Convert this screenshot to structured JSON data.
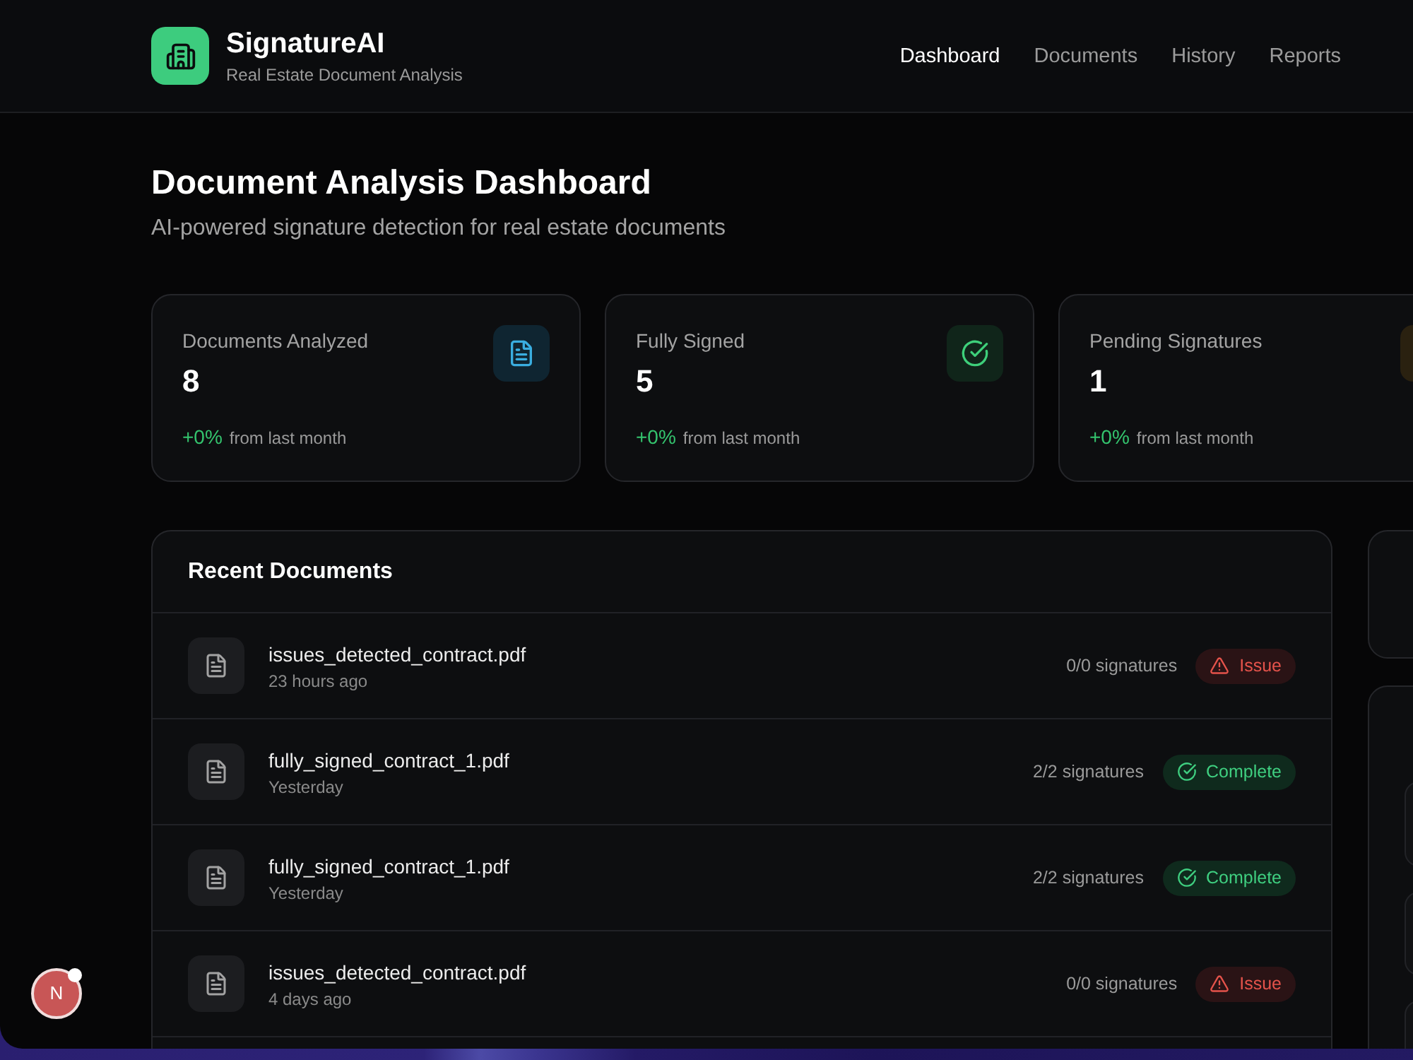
{
  "header": {
    "app_name": "SignatureAI",
    "tagline": "Real Estate Document Analysis",
    "nav": [
      {
        "label": "Dashboard",
        "selected": true
      },
      {
        "label": "Documents",
        "selected": false
      },
      {
        "label": "History",
        "selected": false
      },
      {
        "label": "Reports",
        "selected": false
      }
    ]
  },
  "intro": {
    "title": "Document Analysis Dashboard",
    "subtitle": "AI-powered signature detection for real estate documents"
  },
  "stats": [
    {
      "kind": "documents",
      "label": "Documents Analyzed",
      "value": "8",
      "change": "+0%",
      "period": "from last month"
    },
    {
      "kind": "signed",
      "label": "Fully Signed",
      "value": "5",
      "change": "+0%",
      "period": "from last month"
    },
    {
      "kind": "pending",
      "label": "Pending Signatures",
      "value": "1",
      "change": "+0%",
      "period": "from last month"
    }
  ],
  "recent_documents": {
    "title": "Recent Documents",
    "rows": [
      {
        "name": "issues_detected_contract.pdf",
        "time": "23 hours ago",
        "signatures": "0/0 signatures",
        "status": {
          "kind": "issue",
          "label": "Issue"
        }
      },
      {
        "name": "fully_signed_contract_1.pdf",
        "time": "Yesterday",
        "signatures": "2/2 signatures",
        "status": {
          "kind": "complete",
          "label": "Complete"
        }
      },
      {
        "name": "fully_signed_contract_1.pdf",
        "time": "Yesterday",
        "signatures": "2/2 signatures",
        "status": {
          "kind": "complete",
          "label": "Complete"
        }
      },
      {
        "name": "issues_detected_contract.pdf",
        "time": "4 days ago",
        "signatures": "0/0 signatures",
        "status": {
          "kind": "issue",
          "label": "Issue"
        }
      }
    ]
  },
  "side_panels": [
    {
      "kind": "blank"
    },
    {
      "kind": "list"
    }
  ],
  "dev_indicator": {
    "label": "N"
  }
}
